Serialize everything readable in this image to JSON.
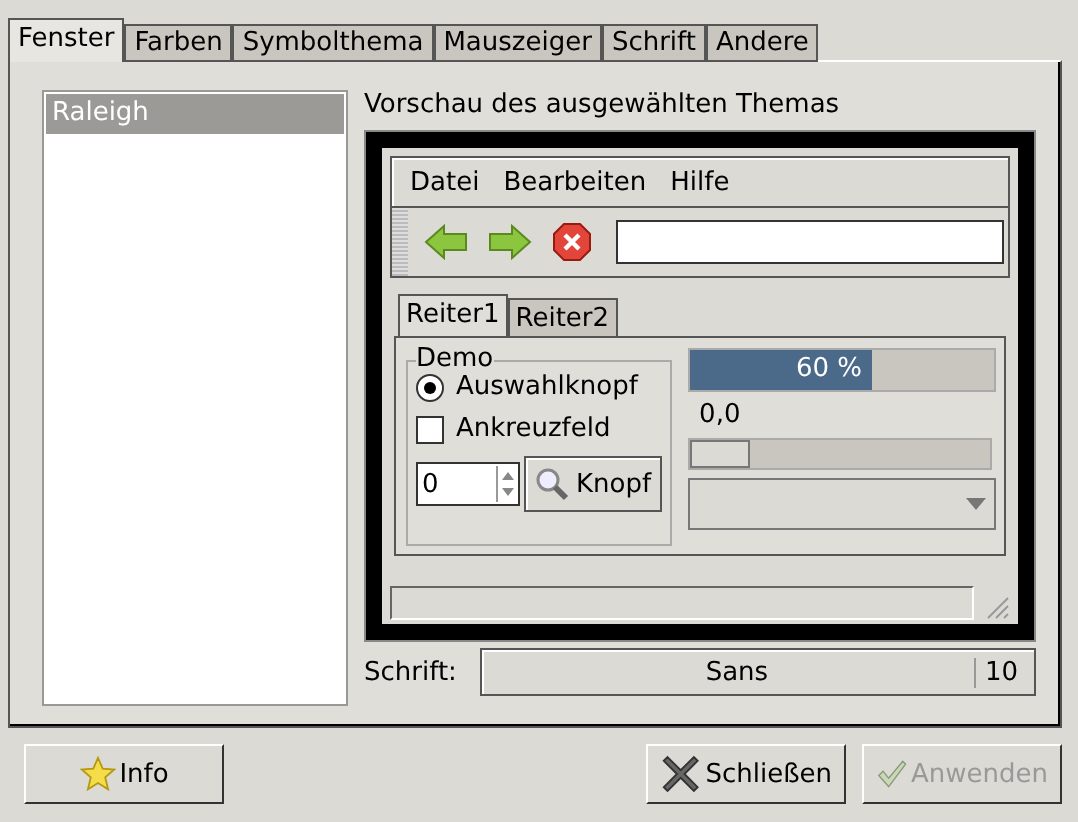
{
  "tabs": [
    {
      "label": "Fenster",
      "selected": true
    },
    {
      "label": "Farben",
      "selected": false
    },
    {
      "label": "Symbolthema",
      "selected": false
    },
    {
      "label": "Mauszeiger",
      "selected": false
    },
    {
      "label": "Schrift",
      "selected": false
    },
    {
      "label": "Andere",
      "selected": false
    }
  ],
  "themes": [
    {
      "label": "Raleigh",
      "selected": true
    }
  ],
  "preview_label": "Vorschau des ausgewählten Themas",
  "preview": {
    "menu": [
      "Datei",
      "Bearbeiten",
      "Hilfe"
    ],
    "tabs": [
      {
        "label": "Reiter1",
        "selected": true
      },
      {
        "label": "Reiter2",
        "selected": false
      }
    ],
    "group_title": "Demo",
    "radio": {
      "label": "Auswahlknopf",
      "checked": true
    },
    "checkbox": {
      "label": "Ankreuzfeld",
      "checked": false
    },
    "spin_value": "0",
    "button": "Knopf",
    "progress": {
      "level": 0.6,
      "text": "60 %"
    },
    "scale_value": "0,0",
    "scale": {
      "level": 0.2
    }
  },
  "font": {
    "label": "Schrift:",
    "name": "Sans",
    "size": "10"
  },
  "buttons": [
    {
      "label": "Info",
      "disabled": false
    },
    {
      "label": "Schließen",
      "disabled": false
    },
    {
      "label": "Anwenden",
      "disabled": true
    }
  ]
}
